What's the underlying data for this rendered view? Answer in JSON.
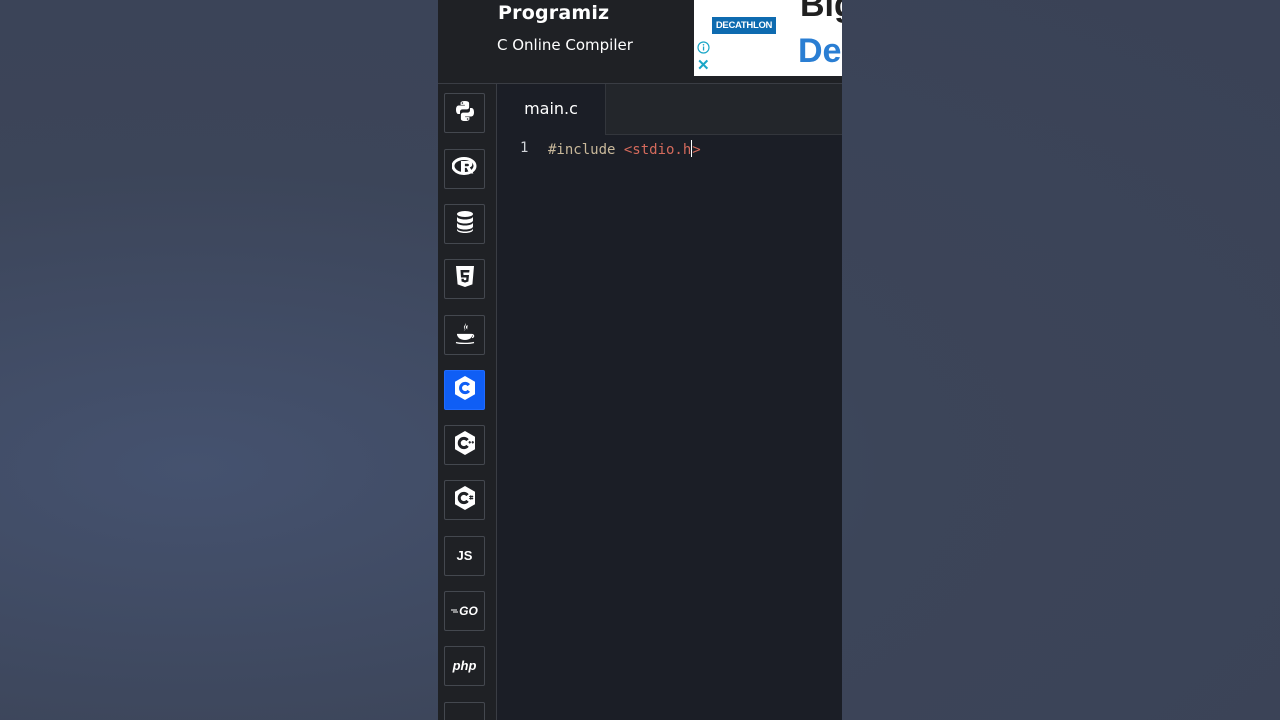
{
  "header": {
    "logo_text": "Programiz",
    "subtitle": "C Online Compiler"
  },
  "ad": {
    "brand": "DECATHLON",
    "headline_line1": "Big",
    "headline_line2": "De",
    "info_icon": "info-icon",
    "close_icon": "close-icon"
  },
  "sidebar": {
    "items": [
      {
        "id": "python",
        "icon": "python-icon",
        "label": ""
      },
      {
        "id": "r",
        "icon": "r-icon",
        "label": ""
      },
      {
        "id": "sql",
        "icon": "database-icon",
        "label": ""
      },
      {
        "id": "html",
        "icon": "html5-icon",
        "label": ""
      },
      {
        "id": "java",
        "icon": "java-icon",
        "label": ""
      },
      {
        "id": "c",
        "icon": "c-icon",
        "label": "",
        "active": true
      },
      {
        "id": "cpp",
        "icon": "cpp-icon",
        "label": ""
      },
      {
        "id": "csharp",
        "icon": "csharp-icon",
        "label": ""
      },
      {
        "id": "js",
        "icon": "js-icon",
        "label": "JS"
      },
      {
        "id": "go",
        "icon": "go-icon",
        "label": "GO"
      },
      {
        "id": "php",
        "icon": "php-icon",
        "label": "php"
      },
      {
        "id": "swift",
        "icon": "swift-icon",
        "label": ""
      }
    ]
  },
  "editor": {
    "tab_label": "main.c",
    "lines": [
      {
        "number": "1",
        "directive": "#include ",
        "header": "<stdio.h",
        "after_cursor": ">"
      }
    ]
  },
  "colors": {
    "active_language": "#0f5ef5",
    "keyword": "#c8b89a",
    "string": "#d46a5c",
    "editor_bg": "#1b1e26"
  }
}
